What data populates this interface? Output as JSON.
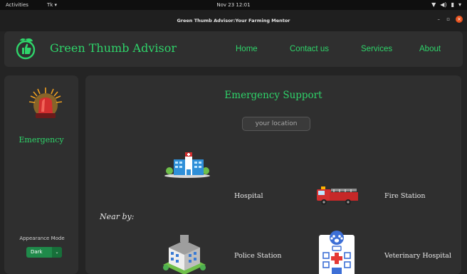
{
  "system_bar": {
    "activities": "Activities",
    "app_menu": "Tk ▾",
    "clock": "Nov 23  12:01",
    "tray": [
      "▼",
      "◀)",
      "▮",
      "▾"
    ]
  },
  "window": {
    "title": "Green Thumb Advisor:Your Farming Mentor",
    "min": "–",
    "max": "▫",
    "close": "×"
  },
  "header": {
    "logo_icon": "plant-thumbs-up-icon",
    "brand": "Green Thumb Advisor",
    "nav": [
      "Home",
      "Contact us",
      "Services",
      "About"
    ]
  },
  "sidebar": {
    "alarm_icon": "emergency-siren-icon",
    "emergency_label": "Emergency",
    "appearance_label": "Appearance Mode",
    "appearance_value": "Dark",
    "dropdown_arrow": "⌄"
  },
  "main": {
    "heading": "Emergency Support",
    "location_placeholder": "your location",
    "nearby": "Near by:",
    "places": {
      "hospital": "Hospital",
      "fire_station": "Fire Station",
      "police_station": "Police Station",
      "veterinary_hospital": "Veterinary Hospital"
    }
  },
  "colors": {
    "accent_green": "#2fd46a",
    "panel": "#2f2f2f",
    "background": "#242424",
    "close_button": "#e95420"
  }
}
